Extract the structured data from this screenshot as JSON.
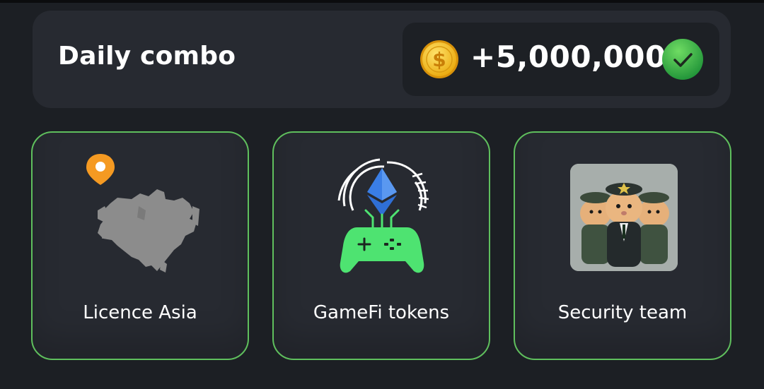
{
  "combo": {
    "title": "Daily combo",
    "reward": "+5,000,000",
    "coin_icon": "dollar-coin-icon",
    "status_icon": "checkmark-icon",
    "status": "completed"
  },
  "cards": [
    {
      "label": "Licence Asia",
      "icon": "asia-map-with-location-pin-icon"
    },
    {
      "label": "GameFi tokens",
      "icon": "ethereum-gamepad-icon"
    },
    {
      "label": "Security team",
      "icon": "hamster-security-team-image"
    }
  ],
  "colors": {
    "background": "#1c1f24",
    "panel": "#272a31",
    "pill": "#1d2025",
    "card_border": "#5fbf5d",
    "coin": "#f4c21c",
    "check": "#3cb24a",
    "gamepad": "#4ee371",
    "ethereum": "#3a7ee6",
    "pin": "#f59a22"
  }
}
